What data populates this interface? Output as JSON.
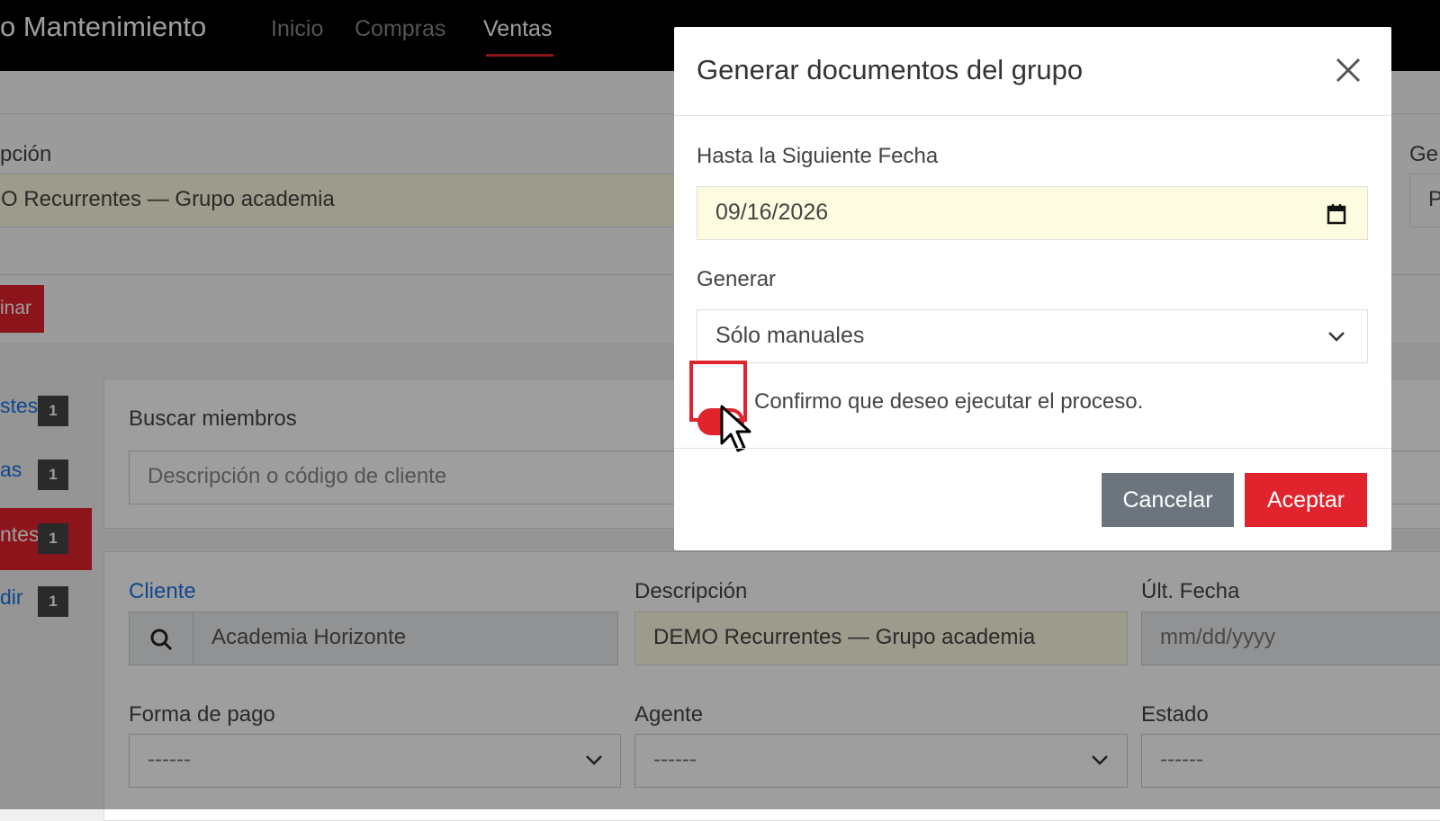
{
  "navbar": {
    "brand": "o Mantenimiento",
    "links": [
      {
        "label": "Inicio",
        "active": false
      },
      {
        "label": "Compras",
        "active": false
      },
      {
        "label": "Ventas",
        "active": true
      }
    ]
  },
  "background": {
    "desc_label": "pción",
    "desc_value": "O Recurrentes — Grupo academia",
    "right_label": "Ge",
    "right_value": "P",
    "red_button": "inar",
    "sidebar": [
      {
        "label": "stes",
        "badge": "1"
      },
      {
        "label": "as",
        "badge": "1"
      },
      {
        "label": "ntes",
        "badge": "1"
      },
      {
        "label": "dir",
        "badge": "1"
      }
    ],
    "search": {
      "label": "Buscar miembros",
      "placeholder": "Descripción o código de cliente"
    },
    "form": {
      "cliente_label": "Cliente",
      "cliente_value": "Academia Horizonte",
      "descripcion_label": "Descripción",
      "descripcion_value": "DEMO Recurrentes — Grupo academia",
      "ult_fecha_label": "Últ. Fecha",
      "ult_fecha_placeholder": "mm/dd/yyyy",
      "forma_pago_label": "Forma de pago",
      "forma_pago_value": "------",
      "agente_label": "Agente",
      "agente_value": "------",
      "estado_label": "Estado",
      "estado_value": "------"
    }
  },
  "modal": {
    "title": "Generar documentos del grupo",
    "date_label": "Hasta la Siguiente Fecha",
    "date_value": "09/16/2026",
    "generate_label": "Generar",
    "generate_value": "Sólo manuales",
    "confirm_text": "Confirmo que deseo ejecutar el proceso.",
    "confirm_checked": true,
    "cancel_label": "Cancelar",
    "accept_label": "Aceptar"
  },
  "colors": {
    "accent": "#e0232c",
    "navbar": "#000000",
    "highlight_field": "#fefce0",
    "cancel": "#6c757d"
  },
  "icons": [
    "close-icon",
    "calendar-icon",
    "chevron-down-icon",
    "search-icon",
    "mouse-cursor-icon"
  ]
}
